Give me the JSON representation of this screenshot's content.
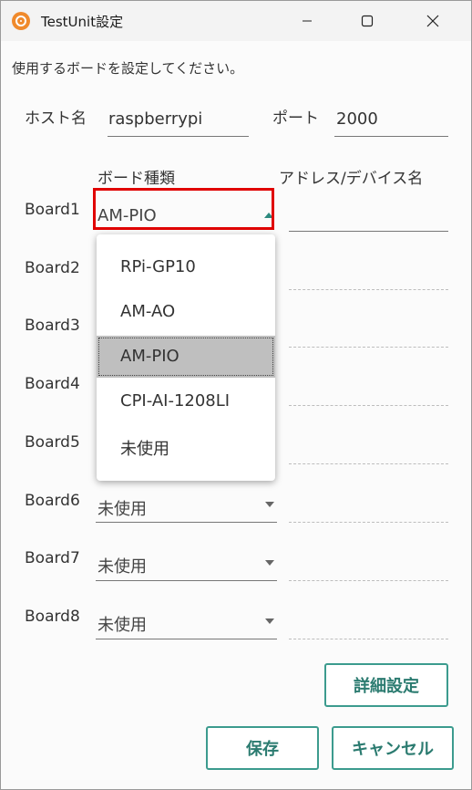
{
  "window": {
    "title": "TestUnit設定",
    "icon": "app-target-icon"
  },
  "instruction": "使用するボードを設定してください。",
  "host": {
    "label": "ホスト名",
    "value": "raspberrypi"
  },
  "port": {
    "label": "ポート",
    "value": "2000"
  },
  "columns": {
    "board_type": "ボード種類",
    "address": "アドレス/デバイス名"
  },
  "boards": [
    {
      "label": "Board1",
      "value": "AM-PIO",
      "address": ""
    },
    {
      "label": "Board2",
      "value": "",
      "address": ""
    },
    {
      "label": "Board3",
      "value": "",
      "address": ""
    },
    {
      "label": "Board4",
      "value": "",
      "address": ""
    },
    {
      "label": "Board5",
      "value": "",
      "address": ""
    },
    {
      "label": "Board6",
      "value": "未使用",
      "address": ""
    },
    {
      "label": "Board7",
      "value": "未使用",
      "address": ""
    },
    {
      "label": "Board8",
      "value": "未使用",
      "address": ""
    }
  ],
  "dropdown": {
    "options": [
      "RPi-GP10",
      "AM-AO",
      "AM-PIO",
      "CPI-AI-1208LI",
      "未使用"
    ],
    "selected": "AM-PIO"
  },
  "buttons": {
    "details": "詳細設定",
    "save": "保存",
    "cancel": "キャンセル"
  },
  "colors": {
    "accent": "#2d8a7e",
    "highlight_border": "#e00000",
    "selected_option": "#bfbfbf"
  }
}
